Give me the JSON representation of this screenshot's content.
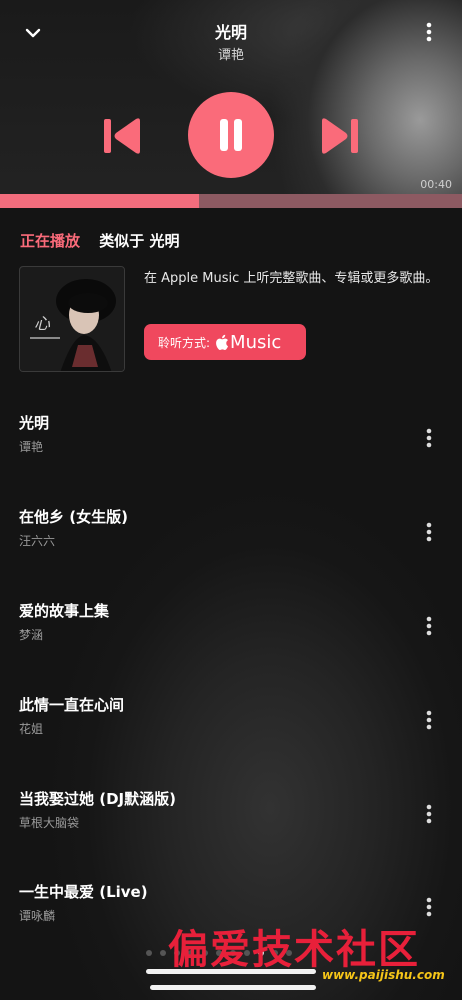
{
  "header": {
    "title": "光明",
    "artist": "谭艳"
  },
  "playback": {
    "time_remaining": "00:40",
    "progress_fraction": 0.43
  },
  "tabs": {
    "now_playing": "正在播放",
    "similar": "类似于 光明"
  },
  "promo": {
    "text": "在 Apple Music 上听完整歌曲、专辑或更多歌曲。",
    "listen_label": "聆听方式:",
    "music_word": "Music"
  },
  "songs": [
    {
      "title": "光明",
      "artist": "谭艳"
    },
    {
      "title": "在他乡 (女生版)",
      "artist": "汪六六"
    },
    {
      "title": "爱的故事上集",
      "artist": "梦涵"
    },
    {
      "title": "此情一直在心间",
      "artist": "花姐"
    },
    {
      "title": "当我娶过她 (DJ默涵版)",
      "artist": "草根大脑袋"
    },
    {
      "title": "一生中最爱 (Live)",
      "artist": "谭咏麟"
    }
  ],
  "watermark": {
    "text": "偏爱技术社区",
    "url": "www.paijishu.com"
  },
  "colors": {
    "accent": "#fa6b7a",
    "button": "#f0485e",
    "progress": "#f26d7d"
  }
}
